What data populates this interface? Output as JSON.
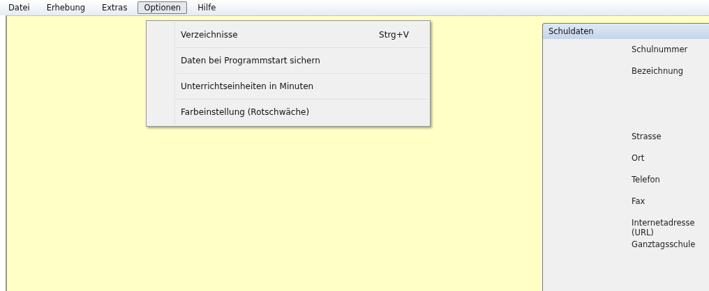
{
  "menu_bar": [
    {
      "label": "Datei",
      "selected": false
    },
    {
      "label": "Erhebung",
      "selected": false
    },
    {
      "label": "Extras",
      "selected": false
    },
    {
      "label": "Optionen",
      "selected": true
    },
    {
      "label": "Hilfe",
      "selected": false
    }
  ],
  "dropdown": {
    "items": [
      {
        "label": "Verzeichnisse",
        "shortcut": "Strg+V"
      },
      {
        "label": "Daten bei Programmstart sichern"
      },
      {
        "label": "Unterrichtseinheiten in Minuten"
      },
      {
        "label": "Farbeinstellung (Rotschwäche)"
      }
    ]
  },
  "panel": {
    "title": "Schuldaten",
    "fields": [
      {
        "label": "Schulnummer",
        "kind": "line"
      },
      {
        "label": "Bezeichnung",
        "kind": "multiline"
      },
      {
        "label": "Strasse",
        "kind": "line"
      },
      {
        "label": "Ort",
        "kind": "line"
      },
      {
        "label": "Telefon",
        "kind": "line"
      },
      {
        "label": "Fax",
        "kind": "line"
      },
      {
        "label": "Internetadresse\n(URL)",
        "kind": "line"
      },
      {
        "label": "Ganztagsschule",
        "kind": "line"
      }
    ]
  }
}
